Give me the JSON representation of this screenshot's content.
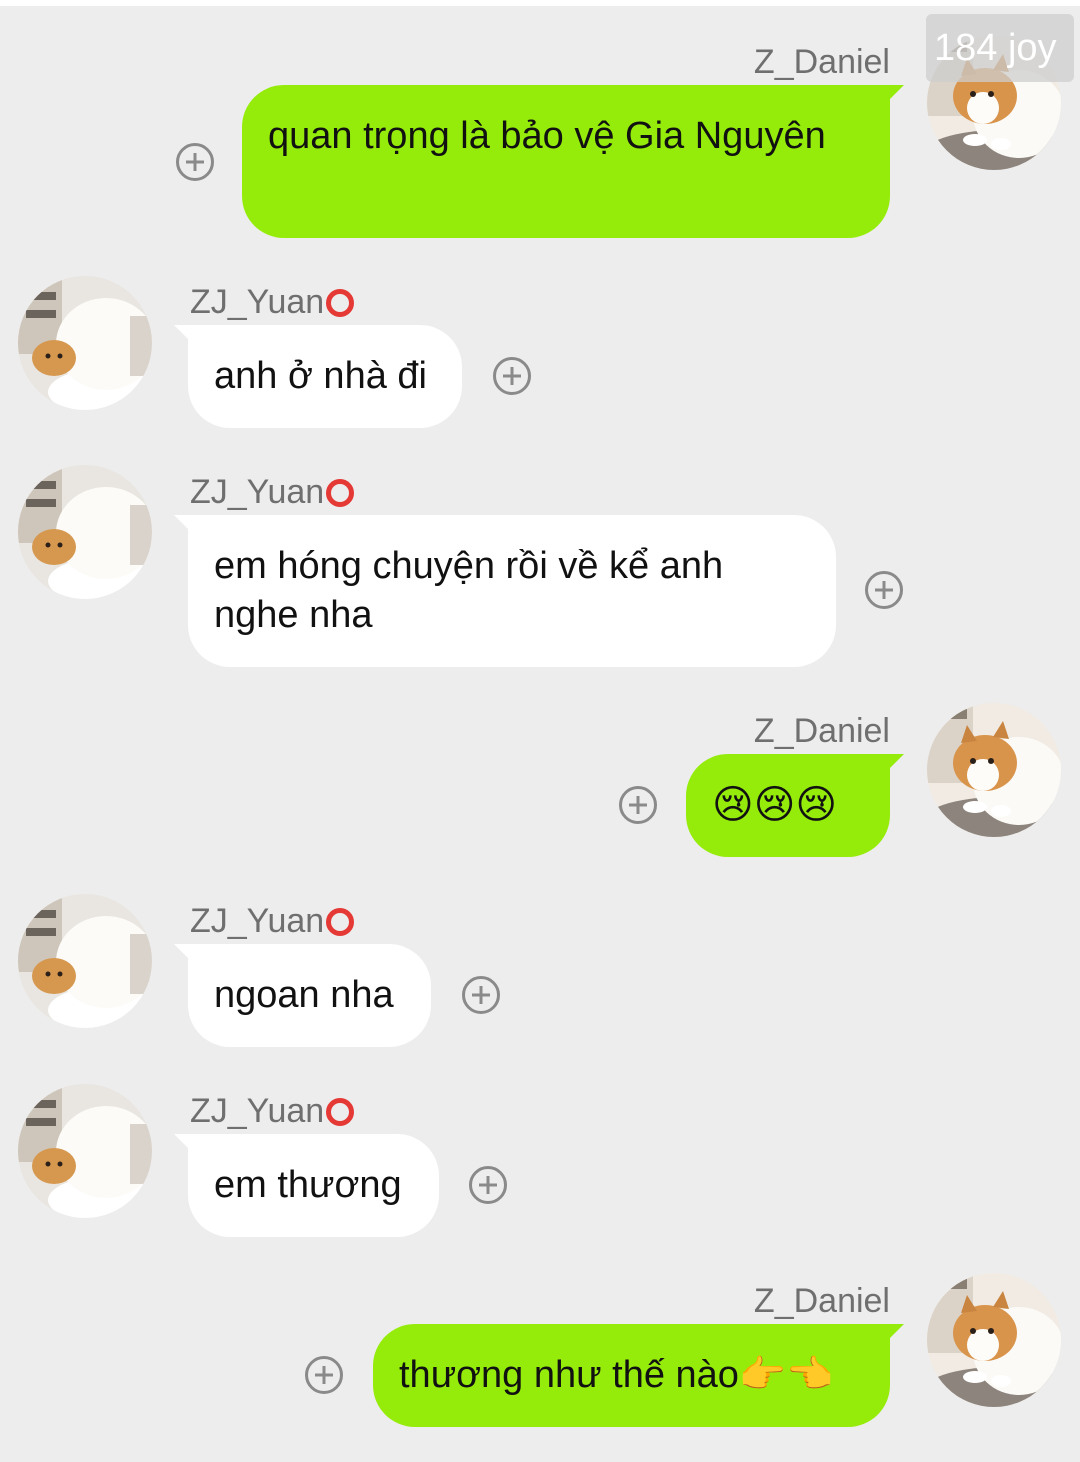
{
  "watermark": "184 joy",
  "conversation": {
    "messages": [
      {
        "sender": "Z_Daniel",
        "side": "me",
        "text": "quan trọng là bảo vệ Gia Nguyên"
      },
      {
        "sender": "ZJ_Yuan",
        "side": "them",
        "text": "anh ở nhà đi"
      },
      {
        "sender": "ZJ_Yuan",
        "side": "them",
        "text": "em hóng chuyện rồi về kể anh nghe nha"
      },
      {
        "sender": "Z_Daniel",
        "side": "me",
        "text": "😢😢😢"
      },
      {
        "sender": "ZJ_Yuan",
        "side": "them",
        "text": "ngoan nha"
      },
      {
        "sender": "ZJ_Yuan",
        "side": "them",
        "text": "em thương"
      },
      {
        "sender": "Z_Daniel",
        "side": "me",
        "text": "thương như thế nào👉👈"
      }
    ]
  },
  "colors": {
    "background": "#ededed",
    "my_bubble": "#95ec0a",
    "their_bubble": "#ffffff",
    "status_ring": "#e53935"
  },
  "icons": {
    "message_action": "plus-circle-icon",
    "yuan_status": "red-ring-icon",
    "avatar_daniel": "orange-white-cat-avatar",
    "avatar_yuan": "white-cat-avatar"
  }
}
